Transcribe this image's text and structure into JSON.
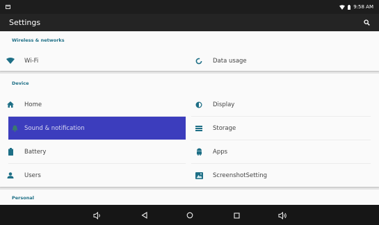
{
  "status_bar": {
    "time": "9:58 AM",
    "icons": [
      "notification-icon",
      "wifi-icon",
      "battery-icon"
    ]
  },
  "app_bar": {
    "title": "Settings",
    "icons": [
      "search-icon"
    ]
  },
  "sections": [
    {
      "title": "Wireless & networks",
      "items": [
        {
          "label": "Wi-Fi",
          "icon": "wifi-icon"
        },
        {
          "label": "Data usage",
          "icon": "data-usage-icon"
        }
      ]
    },
    {
      "title": "Device",
      "items": [
        {
          "label": "Home",
          "icon": "home-icon"
        },
        {
          "label": "Display",
          "icon": "brightness-icon"
        },
        {
          "label": "Sound & notification",
          "icon": "bell-icon",
          "selected": true
        },
        {
          "label": "Storage",
          "icon": "storage-icon"
        },
        {
          "label": "Battery",
          "icon": "battery-icon"
        },
        {
          "label": "Apps",
          "icon": "android-icon"
        },
        {
          "label": "Users",
          "icon": "user-icon"
        },
        {
          "label": "ScreenshotSetting",
          "icon": "screenshot-icon"
        }
      ]
    },
    {
      "title": "Personal",
      "items": []
    }
  ],
  "nav_bar": {
    "buttons": [
      "volume-down-icon",
      "back-icon",
      "home-icon",
      "recents-icon",
      "volume-up-icon"
    ]
  },
  "colors": {
    "accent": "#1e6f86",
    "icon": "#1e6f86",
    "selected_bg": "#3c3dbd",
    "status_bar": "#1d1d1d",
    "app_bar": "#242424",
    "nav_bar": "#161616"
  }
}
